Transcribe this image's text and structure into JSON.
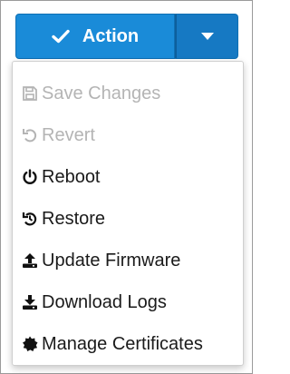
{
  "action_button": {
    "label": "Action",
    "icon": "check-icon",
    "toggle_icon": "caret-down-icon",
    "color": "#1a8bd8"
  },
  "menu": {
    "items": [
      {
        "label": "Save Changes",
        "icon": "save-icon",
        "disabled": true
      },
      {
        "label": "Revert",
        "icon": "undo-icon",
        "disabled": true
      },
      {
        "label": "Reboot",
        "icon": "power-icon",
        "disabled": false
      },
      {
        "label": "Restore",
        "icon": "restore-icon",
        "disabled": false
      },
      {
        "label": "Update Firmware",
        "icon": "upload-icon",
        "disabled": false
      },
      {
        "label": "Download Logs",
        "icon": "download-icon",
        "disabled": false
      },
      {
        "label": "Manage Certificates",
        "icon": "certificate-icon",
        "disabled": false
      }
    ]
  }
}
